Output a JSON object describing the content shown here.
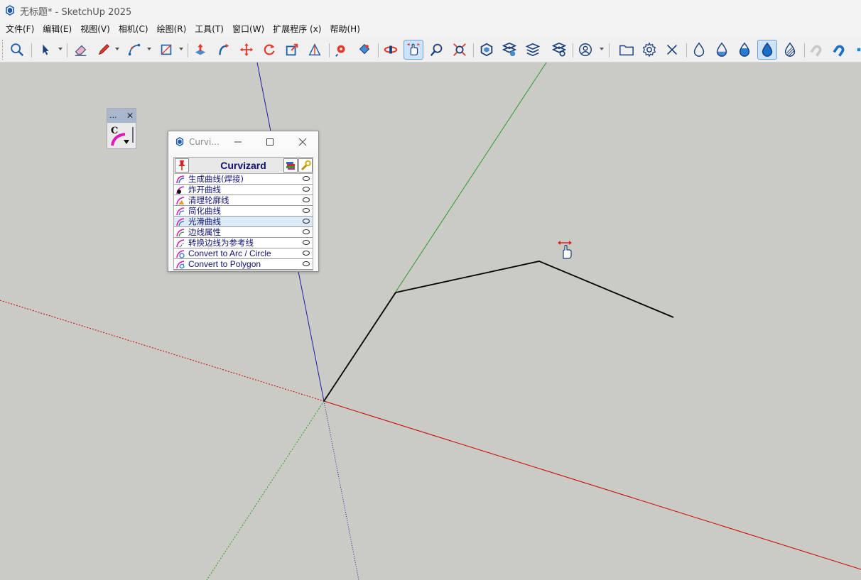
{
  "window": {
    "title": "无标题* - SketchUp 2025"
  },
  "menu": [
    {
      "label": "文件(F)"
    },
    {
      "label": "编辑(E)"
    },
    {
      "label": "视图(V)"
    },
    {
      "label": "相机(C)"
    },
    {
      "label": "绘图(R)"
    },
    {
      "label": "工具(T)"
    },
    {
      "label": "窗口(W)"
    },
    {
      "label": "扩展程序 (x)"
    },
    {
      "label": "帮助(H)"
    }
  ],
  "toolbar": {
    "tools": [
      {
        "name": "zoom-extents-icon"
      },
      {
        "name": "select-icon"
      },
      {
        "name": "eraser-icon"
      },
      {
        "name": "pencil-icon"
      },
      {
        "name": "arc-icon"
      },
      {
        "name": "rectangle-icon"
      },
      {
        "name": "push-pull-icon"
      },
      {
        "name": "follow-me-icon"
      },
      {
        "name": "move-icon"
      },
      {
        "name": "rotate-icon"
      },
      {
        "name": "scale-icon"
      },
      {
        "name": "protractor-icon"
      },
      {
        "name": "paint-bucket-icon"
      },
      {
        "name": "tape-icon"
      },
      {
        "name": "orbit-icon"
      },
      {
        "name": "pan-icon",
        "active": true
      },
      {
        "name": "zoom-icon"
      },
      {
        "name": "zoom-window-icon"
      },
      {
        "name": "components-icon"
      },
      {
        "name": "outliner-icon"
      },
      {
        "name": "layers-icon"
      },
      {
        "name": "styles-icon"
      },
      {
        "name": "account-icon"
      },
      {
        "name": "folder-icon"
      },
      {
        "name": "settings-icon"
      },
      {
        "name": "close-icon"
      },
      {
        "name": "drop-empty-icon"
      },
      {
        "name": "drop-half-icon"
      },
      {
        "name": "drop-most-icon"
      },
      {
        "name": "drop-full-icon",
        "active": true
      },
      {
        "name": "drop-hatched-icon"
      },
      {
        "name": "magnet-gray-icon"
      },
      {
        "name": "magnet-blue-icon"
      }
    ]
  },
  "curvizard": {
    "window_title": "Curvi...",
    "header": "Curvizard",
    "items": [
      {
        "label": "生成曲线(焊接)"
      },
      {
        "label": "炸开曲线"
      },
      {
        "label": "清理轮廓线"
      },
      {
        "label": "简化曲线"
      },
      {
        "label": "光滑曲线",
        "selected": true
      },
      {
        "label": "边线属性"
      },
      {
        "label": "转换边线为参考线"
      },
      {
        "label": "Convert to Arc / Circle"
      },
      {
        "label": "Convert to Polygon"
      }
    ]
  },
  "mini_panel": {
    "title_dots": "..."
  },
  "colors": {
    "viewport_bg": "#cbcbc6",
    "axis_red": "#cc0000",
    "axis_green": "#2a9a2a",
    "axis_blue": "#1a1aaa",
    "active_tool_bg": "#cfe3f7",
    "curvizard_text": "#101070"
  }
}
